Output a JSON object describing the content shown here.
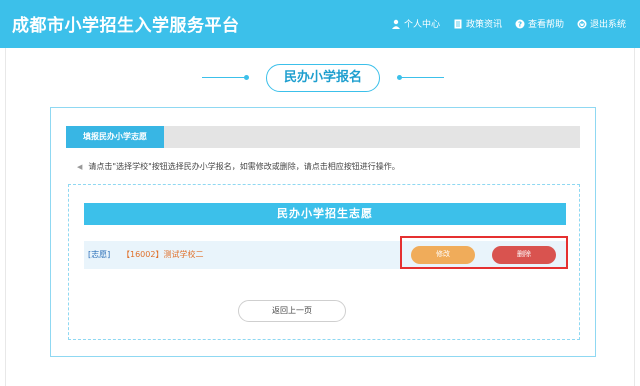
{
  "header": {
    "title": "成都市小学招生入学服务平台",
    "nav": [
      {
        "label": "个人中心",
        "icon": "user-icon"
      },
      {
        "label": "政策资讯",
        "icon": "document-icon"
      },
      {
        "label": "查看帮助",
        "icon": "help-icon"
      },
      {
        "label": "退出系统",
        "icon": "power-icon"
      }
    ]
  },
  "section": {
    "title": "民办小学报名"
  },
  "card": {
    "tab_label": "填报民办小学志愿",
    "tip": "请点击\"选择学校\"按钮选择民办小学报名，如需修改或删除，请点击相应按钮进行操作。"
  },
  "volunteer": {
    "heading": "民办小学招生志愿",
    "tag": "[志愿]",
    "school": "【16002】测试学校二",
    "edit_label": "修改",
    "delete_label": "删除"
  },
  "footer": {
    "back_label": "返回上一页"
  },
  "colors": {
    "primary": "#3cc0ea",
    "edit": "#f0ac5a",
    "delete": "#d9534f",
    "highlight": "#e53030"
  }
}
